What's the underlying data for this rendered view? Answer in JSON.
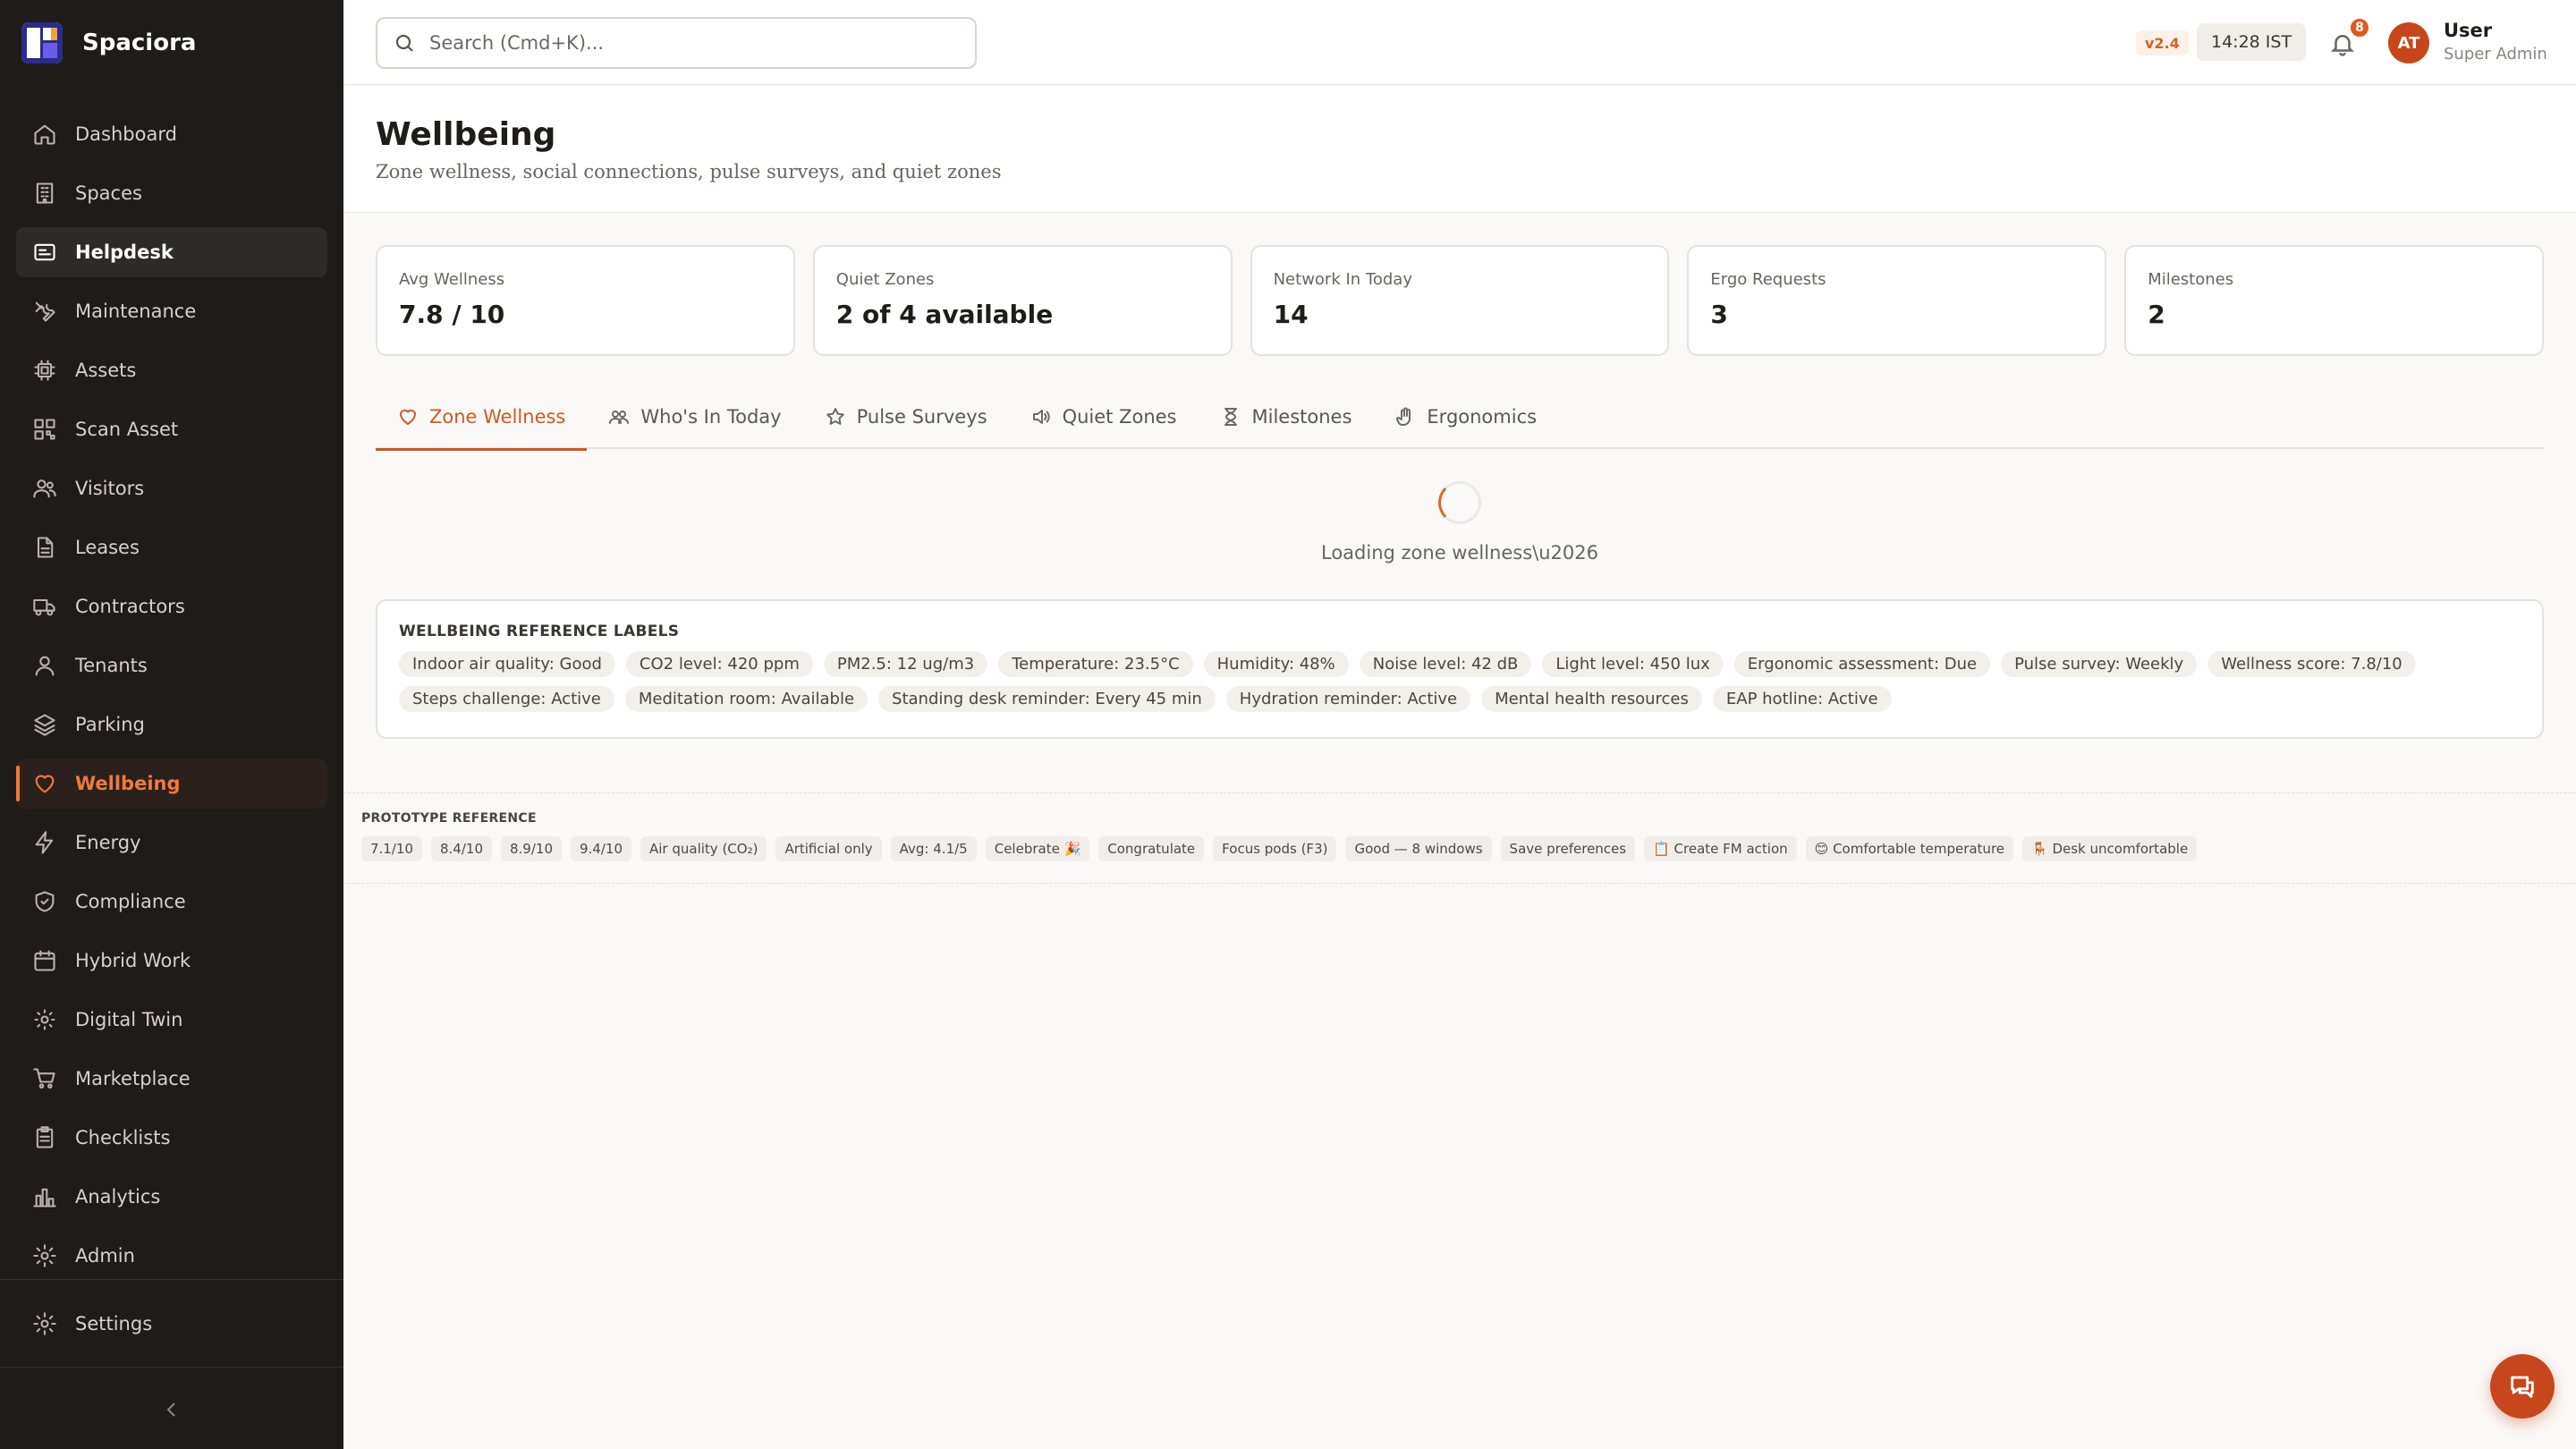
{
  "app": {
    "name": "Spaciora",
    "version": "v2.4",
    "time": "14:28 IST",
    "notification_count": "8"
  },
  "user": {
    "initials": "AT",
    "name": "User",
    "role": "Super Admin"
  },
  "search": {
    "placeholder": "Search (Cmd+K)..."
  },
  "sidebar": {
    "items": [
      {
        "label": "Dashboard",
        "icon": "home-icon"
      },
      {
        "label": "Spaces",
        "icon": "building-icon"
      },
      {
        "label": "Helpdesk",
        "icon": "ticket-icon"
      },
      {
        "label": "Maintenance",
        "icon": "wrench-icon"
      },
      {
        "label": "Assets",
        "icon": "chip-icon"
      },
      {
        "label": "Scan Asset",
        "icon": "qr-icon"
      },
      {
        "label": "Visitors",
        "icon": "users-icon"
      },
      {
        "label": "Leases",
        "icon": "document-icon"
      },
      {
        "label": "Contractors",
        "icon": "truck-icon"
      },
      {
        "label": "Tenants",
        "icon": "user-icon"
      },
      {
        "label": "Parking",
        "icon": "layers-icon"
      },
      {
        "label": "Wellbeing",
        "icon": "heart-icon"
      },
      {
        "label": "Energy",
        "icon": "bolt-icon"
      },
      {
        "label": "Compliance",
        "icon": "shield-icon"
      },
      {
        "label": "Hybrid Work",
        "icon": "calendar-icon"
      },
      {
        "label": "Digital Twin",
        "icon": "twin-icon"
      },
      {
        "label": "Marketplace",
        "icon": "cart-icon"
      },
      {
        "label": "Checklists",
        "icon": "checklist-icon"
      },
      {
        "label": "Analytics",
        "icon": "bar-chart-icon"
      },
      {
        "label": "Admin",
        "icon": "gear-icon"
      }
    ],
    "settings_label": "Settings"
  },
  "page": {
    "title": "Wellbeing",
    "subtitle": "Zone wellness, social connections, pulse surveys, and quiet zones"
  },
  "stats": [
    {
      "label": "Avg Wellness",
      "value": "7.8 / 10"
    },
    {
      "label": "Quiet Zones",
      "value": "2 of 4 available"
    },
    {
      "label": "Network In Today",
      "value": "14"
    },
    {
      "label": "Ergo Requests",
      "value": "3"
    },
    {
      "label": "Milestones",
      "value": "2"
    }
  ],
  "tabs": [
    {
      "label": "Zone Wellness",
      "icon": "heart-icon"
    },
    {
      "label": "Who's In Today",
      "icon": "people-icon"
    },
    {
      "label": "Pulse Surveys",
      "icon": "star-icon"
    },
    {
      "label": "Quiet Zones",
      "icon": "speaker-icon"
    },
    {
      "label": "Milestones",
      "icon": "hourglass-icon"
    },
    {
      "label": "Ergonomics",
      "icon": "hand-icon"
    }
  ],
  "loading": {
    "text": "Loading zone wellness\\u2026"
  },
  "reference": {
    "title": "WELLBEING REFERENCE LABELS",
    "chips": [
      "Indoor air quality: Good",
      "CO2 level: 420 ppm",
      "PM2.5: 12 ug/m3",
      "Temperature: 23.5°C",
      "Humidity: 48%",
      "Noise level: 42 dB",
      "Light level: 450 lux",
      "Ergonomic assessment: Due",
      "Pulse survey: Weekly",
      "Wellness score: 7.8/10",
      "Steps challenge: Active",
      "Meditation room: Available",
      "Standing desk reminder: Every 45 min",
      "Hydration reminder: Active",
      "Mental health resources",
      "EAP hotline: Active"
    ]
  },
  "prototype": {
    "title": "PROTOTYPE REFERENCE",
    "chips": [
      "7.1/10",
      "8.4/10",
      "8.9/10",
      "9.4/10",
      "Air quality (CO₂)",
      "Artificial only",
      "Avg: 4.1/5",
      "Celebrate 🎉",
      "Congratulate",
      "Focus pods (F3)",
      "Good — 8 windows",
      "Save preferences",
      "📋 Create FM action",
      "😊 Comfortable temperature",
      "🪑 Desk uncomfortable"
    ]
  },
  "colors": {
    "accent": "#d4581e",
    "sidebar_bg": "#1e1b19",
    "page_bg": "#faf9f7"
  }
}
